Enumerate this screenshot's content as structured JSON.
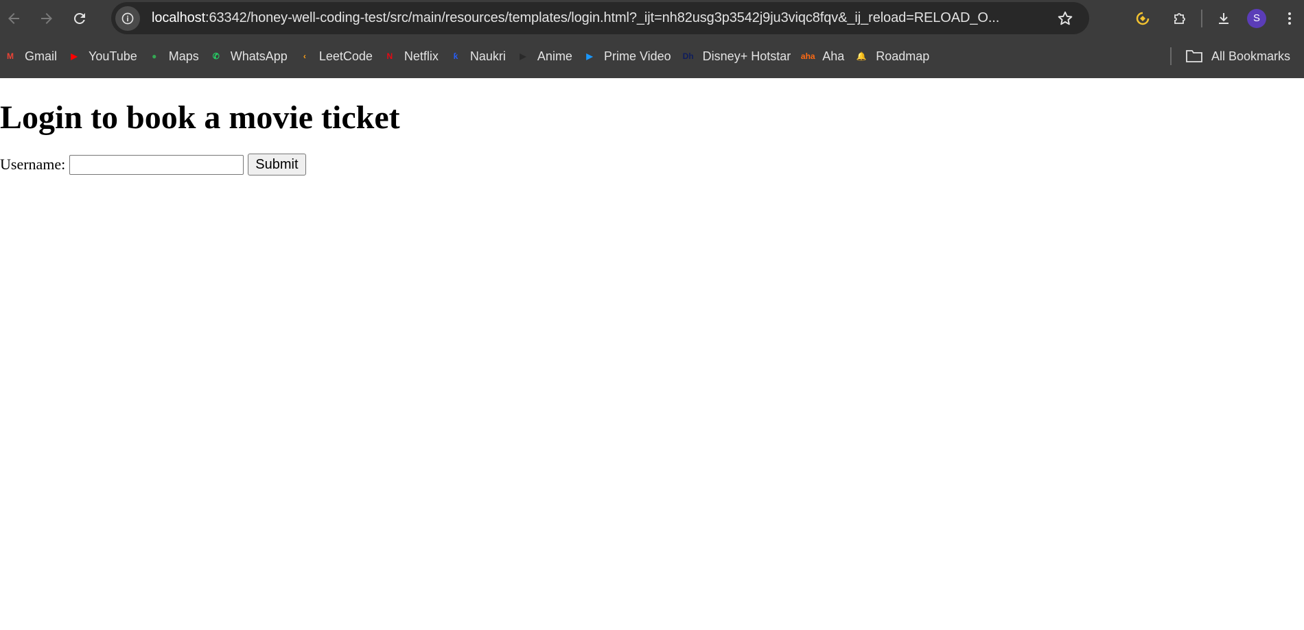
{
  "browser": {
    "url_host": "localhost",
    "url_rest": ":63342/honey-well-coding-test/src/main/resources/templates/login.html?_ijt=nh82usg3p3542j9ju3viqc8fqv&_ij_reload=RELOAD_O...",
    "profile_initial": "S",
    "colors": {
      "chrome_bg": "#3c3c3c",
      "omnibox_bg": "#282828",
      "avatar": "#5b3db8"
    }
  },
  "bookmarks": [
    {
      "label": "Gmail",
      "icon": "gmail-icon",
      "color": "#ea4335",
      "glyph": "M"
    },
    {
      "label": "YouTube",
      "icon": "youtube-icon",
      "color": "#ff0000",
      "glyph": "▶"
    },
    {
      "label": "Maps",
      "icon": "maps-icon",
      "color": "#34a853",
      "glyph": "●"
    },
    {
      "label": "WhatsApp",
      "icon": "whatsapp-icon",
      "color": "#25d366",
      "glyph": "✆"
    },
    {
      "label": "LeetCode",
      "icon": "leetcode-icon",
      "color": "#ffa116",
      "glyph": "‹"
    },
    {
      "label": "Netflix",
      "icon": "netflix-icon",
      "color": "#e50914",
      "glyph": "N"
    },
    {
      "label": "Naukri",
      "icon": "naukri-icon",
      "color": "#275df5",
      "glyph": "ƙ"
    },
    {
      "label": "Anime",
      "icon": "anime-icon",
      "color": "#2a2a2a",
      "glyph": "▶"
    },
    {
      "label": "Prime Video",
      "icon": "prime-video-icon",
      "color": "#1a98ff",
      "glyph": "▶"
    },
    {
      "label": "Disney+ Hotstar",
      "icon": "hotstar-icon",
      "color": "#0f1d5c",
      "glyph": "Dh"
    },
    {
      "label": "Aha",
      "icon": "aha-icon",
      "color": "#ff6a13",
      "glyph": "aha"
    },
    {
      "label": "Roadmap",
      "icon": "roadmap-icon",
      "color": "#ff3b3b",
      "glyph": "🔔"
    }
  ],
  "all_bookmarks_label": "All Bookmarks",
  "page": {
    "heading": "Login to book a movie ticket",
    "username_label": "Username:",
    "username_value": "",
    "submit_label": "Submit"
  }
}
